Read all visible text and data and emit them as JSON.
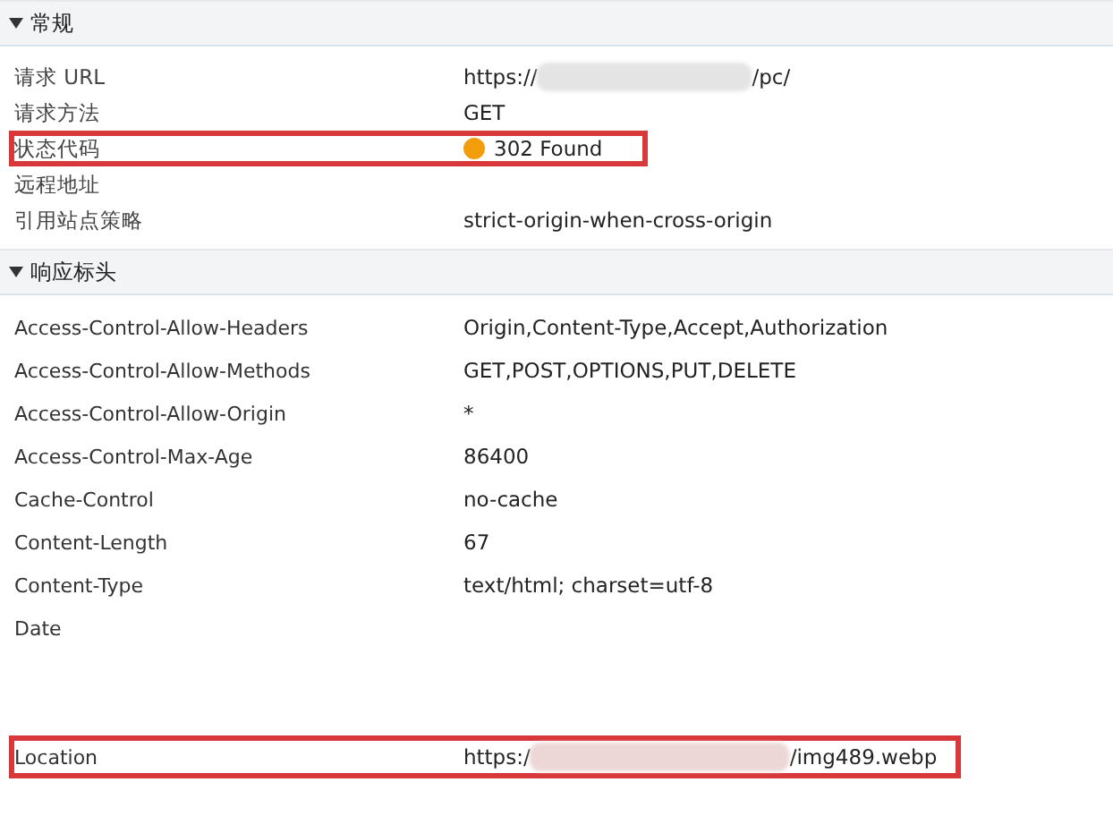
{
  "sections": [
    {
      "title": "常规",
      "expanded": true,
      "rows": [
        {
          "name": "请求 URL",
          "value_start": "https://",
          "redacted": true,
          "value_end": "/pc/",
          "highlighted": false
        },
        {
          "name": "请求方法",
          "value_start": "GET",
          "highlighted": false
        },
        {
          "name": "状态代码",
          "value_start": "302 Found",
          "color": "#f29d0c",
          "highlighted": true
        },
        {
          "name": "远程地址",
          "highlighted": false
        },
        {
          "name": "引用站点策略",
          "value_start": "strict-origin-when-cross-origin",
          "highlighted": false
        }
      ]
    },
    {
      "title": "响应标头",
      "expanded": true,
      "rows": [
        {
          "name": "Access-Control-Allow-Headers",
          "value_start": "Origin,Content-Type,Accept,Authorization",
          "highlighted": false
        },
        {
          "name": "Access-Control-Allow-Methods",
          "value_start": "GET,POST,OPTIONS,PUT,DELETE",
          "highlighted": false
        },
        {
          "name": "Access-Control-Allow-Origin",
          "value_start": "*",
          "highlighted": false
        },
        {
          "name": "Access-Control-Max-Age",
          "value_start": "86400",
          "highlighted": false
        },
        {
          "name": "Cache-Control",
          "value_start": "no-cache",
          "highlighted": false
        },
        {
          "name": "Content-Length",
          "value_start": "67",
          "highlighted": false
        },
        {
          "name": "Content-Type",
          "value_start": "text/html; charset=utf-8",
          "highlighted": false
        },
        {
          "name": "Date",
          "highlighted": false
        },
        {
          "name": "Location",
          "value_start": "https:/",
          "redacted": true,
          "value_end": "/img489.webp",
          "highlighted": true
        }
      ]
    }
  ]
}
